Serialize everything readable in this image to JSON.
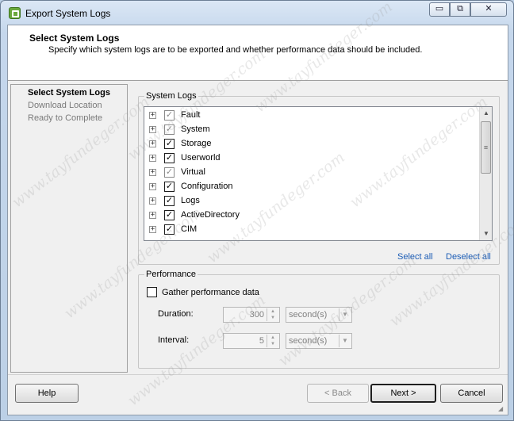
{
  "window": {
    "title": "Export System Logs",
    "controls": {
      "minimize": "▭",
      "maximize": "⧉",
      "close": "✕"
    }
  },
  "header": {
    "title": "Select System Logs",
    "subtitle": "Specify which system logs are to be exported and whether performance data should be included."
  },
  "steps": [
    {
      "label": "Select System Logs",
      "active": true
    },
    {
      "label": "Download Location",
      "active": false
    },
    {
      "label": "Ready to Complete",
      "active": false
    }
  ],
  "system_logs": {
    "legend": "System Logs",
    "items": [
      {
        "label": "Fault",
        "checked": true,
        "dimmed": true
      },
      {
        "label": "System",
        "checked": true,
        "dimmed": true
      },
      {
        "label": "Storage",
        "checked": true,
        "dimmed": false
      },
      {
        "label": "Userworld",
        "checked": true,
        "dimmed": false
      },
      {
        "label": "Virtual",
        "checked": true,
        "dimmed": true
      },
      {
        "label": "Configuration",
        "checked": true,
        "dimmed": false
      },
      {
        "label": "Logs",
        "checked": true,
        "dimmed": false
      },
      {
        "label": "ActiveDirectory",
        "checked": true,
        "dimmed": false
      },
      {
        "label": "CIM",
        "checked": true,
        "dimmed": false
      }
    ],
    "select_all": "Select all",
    "deselect_all": "Deselect all"
  },
  "performance": {
    "legend": "Performance",
    "gather_label": "Gather performance data",
    "gather_checked": false,
    "duration_label": "Duration:",
    "duration_value": "300",
    "duration_unit": "second(s)",
    "interval_label": "Interval:",
    "interval_value": "5",
    "interval_unit": "second(s)"
  },
  "buttons": {
    "help": "Help",
    "back": "< Back",
    "next": "Next >",
    "cancel": "Cancel"
  },
  "watermark": "www.tayfundeger.com",
  "colors": {
    "link": "#1a5bb5",
    "title_bar": "#c5d7ec"
  }
}
